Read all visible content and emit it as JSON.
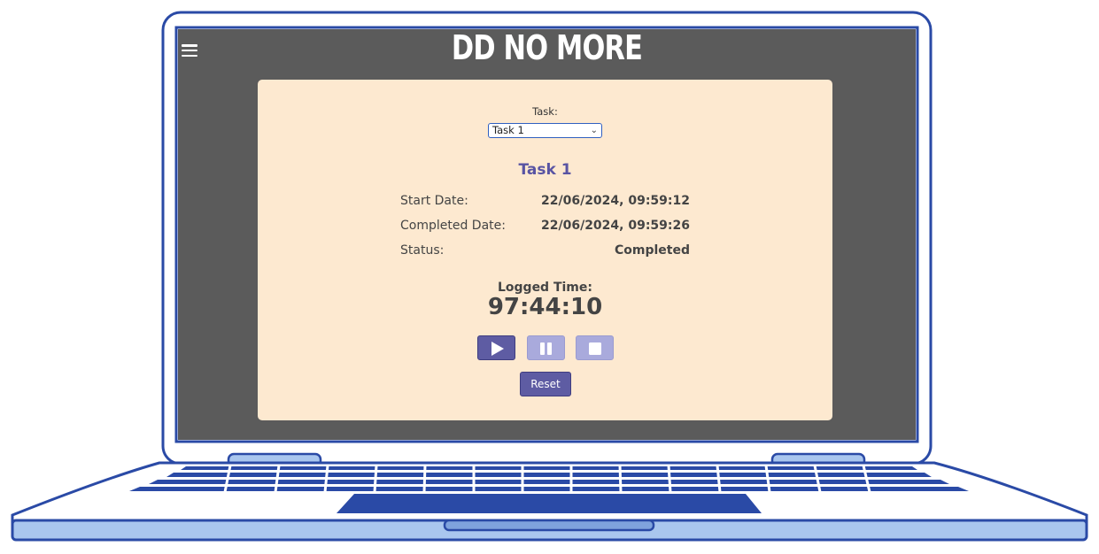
{
  "app": {
    "title": "DD NO MORE"
  },
  "task_select": {
    "label": "Task:",
    "selected": "Task 1"
  },
  "task": {
    "name": "Task 1",
    "details": [
      {
        "label": "Start Date:",
        "value": "22/06/2024, 09:59:12"
      },
      {
        "label": "Completed Date:",
        "value": "22/06/2024, 09:59:26"
      },
      {
        "label": "Status:",
        "value": "Completed"
      }
    ]
  },
  "timer": {
    "label": "Logged Time:",
    "value": "97:44:10"
  },
  "controls": {
    "play_icon": "play-icon",
    "pause_icon": "pause-icon",
    "stop_icon": "stop-icon",
    "reset_label": "Reset"
  },
  "colors": {
    "accent": "#5e5ca3",
    "accent_disabled": "#a9aadc",
    "card_bg": "#fde9d0",
    "screen_bg": "#5b5b5b",
    "laptop_blue": "#2a4aa6"
  }
}
